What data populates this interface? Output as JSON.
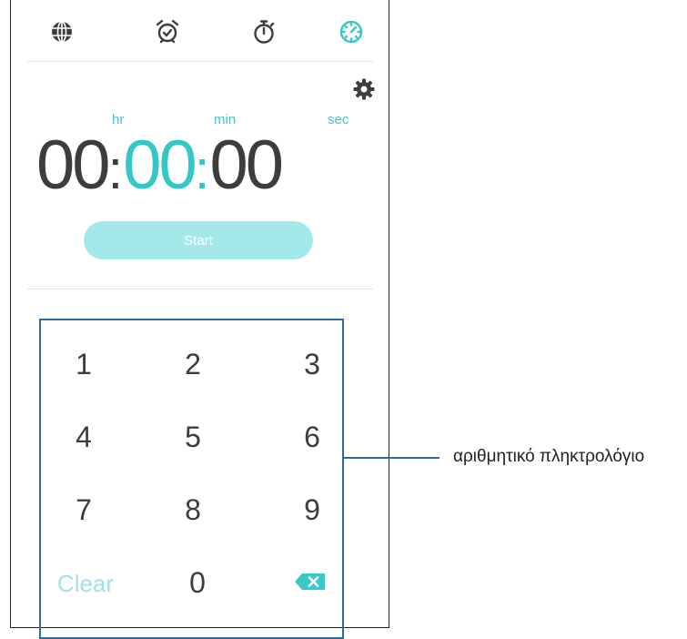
{
  "tabs": {
    "world": "globe-icon",
    "alarm": "alarm-clock-icon",
    "stopwatch": "stopwatch-icon",
    "timer": "timer-icon"
  },
  "timer": {
    "hr_label": "hr",
    "min_label": "min",
    "sec_label": "sec",
    "hours": "00",
    "minutes": "00",
    "seconds": "00",
    "separator": ":",
    "start_label": "Start"
  },
  "keypad": {
    "keys": [
      "1",
      "2",
      "3",
      "4",
      "5",
      "6",
      "7",
      "8",
      "9"
    ],
    "clear_label": "Clear",
    "zero": "0"
  },
  "callout": {
    "label": "αριθμητικό πληκτρολόγιο"
  },
  "colors": {
    "accent": "#35c7c7",
    "start_button": "#a5e8ea",
    "callout_line": "#2d6aa3"
  }
}
